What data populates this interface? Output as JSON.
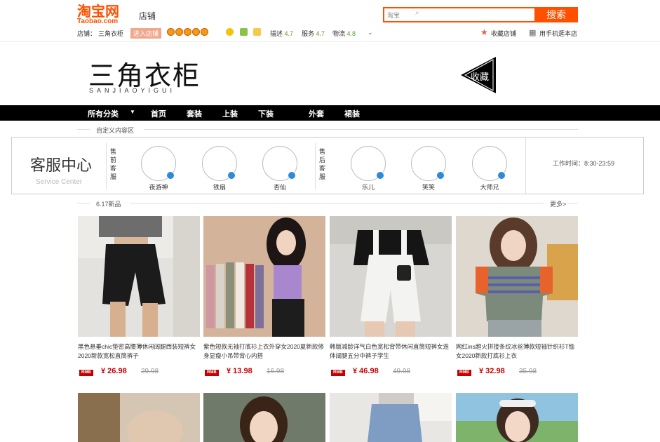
{
  "header": {
    "logo_cn": "淘宝网",
    "logo_en": "Taobao.com",
    "shop_label": "店铺",
    "search": {
      "scope": "淘宝",
      "placeholder": "",
      "button": "搜索"
    }
  },
  "infobar": {
    "shop_prefix": "店铺：",
    "shop_name": "三角衣柜",
    "enter_shop": "进入店铺",
    "rating_desc_label": "描述",
    "rating_desc": "4.7",
    "rating_service_label": "服务",
    "rating_service": "4.7",
    "rating_logistics_label": "物流",
    "rating_logistics": "4.8",
    "favorite": "收藏店铺",
    "mobile": "用手机逛本店"
  },
  "banner": {
    "brand_cn": "三角衣柜",
    "brand_en": "SANJIAOYIGUI",
    "collect": "收藏"
  },
  "nav": {
    "items": [
      "所有分类",
      "首页",
      "套装",
      "上装",
      "下装",
      "外套",
      "裙装"
    ]
  },
  "custom_section": {
    "title": "自定义内容区"
  },
  "service": {
    "title": "客服中心",
    "subtitle": "Service Center",
    "presale_label": "售前客服",
    "aftersale_label": "售后客服",
    "presale_agents": [
      "夜游神",
      "铁扇",
      "杏仙"
    ],
    "aftersale_agents": [
      "乐儿",
      "笑笑",
      "大师兄"
    ],
    "worktime": "工作时间：8:30-23:59"
  },
  "new_section": {
    "title": "6.17新品",
    "more": "更多>"
  },
  "products": [
    {
      "title": "黑色悬垂chic垫密高腰薄休闲阔腿西装短裤女2020新款宽松直筒裤子",
      "rmb": "RMB",
      "price": "¥ 26.98",
      "old_price": "29.98"
    },
    {
      "title": "紫色短款无袖打底衫上衣外穿女2020夏新款修身显瘦小吊带背心内搭",
      "rmb": "RMB",
      "price": "¥ 13.98",
      "old_price": "16.98"
    },
    {
      "title": "韩版减龄洋气白色宽松背带休闲直筒短裤女连体阔腿五分中裤子学生",
      "rmb": "RMB",
      "price": "¥ 46.98",
      "old_price": "49.98"
    },
    {
      "title": "网红ins超火拼接条纹冰丝薄款短袖针织衫T恤女2020新款打底衫上衣",
      "rmb": "RMB",
      "price": "¥ 32.98",
      "old_price": "35.98"
    }
  ],
  "colors": {
    "brand": "#ff5000",
    "price": "#c40000",
    "nav": "#000000"
  }
}
